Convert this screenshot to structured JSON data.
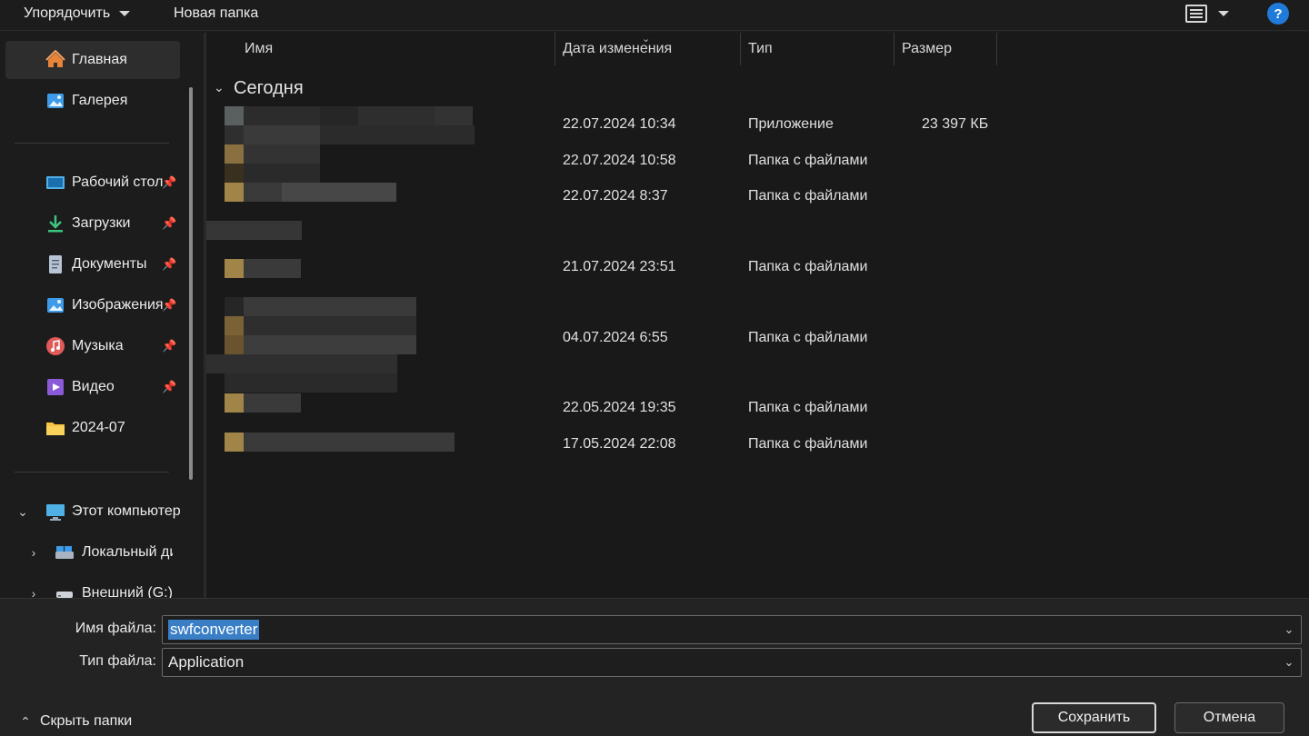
{
  "toolbar": {
    "organize_label": "Упорядочить",
    "new_folder_label": "Новая папка",
    "view_icon": "view-list-icon",
    "help_label": "?"
  },
  "nav": {
    "items": [
      {
        "label": "Главная",
        "icon": "home-icon",
        "color": "#e8833a"
      },
      {
        "label": "Галерея",
        "icon": "gallery-icon",
        "color": "#3d9be9"
      },
      {
        "label": "Рабочий стол",
        "icon": "desktop-icon",
        "color": "#4fb0e6"
      },
      {
        "label": "Загрузки",
        "icon": "download-icon",
        "color": "#3ec57f"
      },
      {
        "label": "Документы",
        "icon": "documents-icon",
        "color": "#b8c4d4"
      },
      {
        "label": "Изображения",
        "icon": "pictures-icon",
        "color": "#3d9be9"
      },
      {
        "label": "Музыка",
        "icon": "music-icon",
        "color": "#e05a5a"
      },
      {
        "label": "Видео",
        "icon": "video-icon",
        "color": "#8a5ad8"
      },
      {
        "label": "2024-07",
        "icon": "folder-icon",
        "color": "#f5c542"
      }
    ],
    "this_pc_label": "Этот компьютер",
    "drives": [
      {
        "label": "Локальный диск",
        "icon": "local-disk-icon"
      },
      {
        "label": "Внешний (G:)",
        "icon": "external-drive-icon"
      }
    ]
  },
  "list": {
    "columns": {
      "name": "Имя",
      "date": "Дата изменения",
      "type": "Тип",
      "size": "Размер"
    },
    "group_label": "Сегодня",
    "rows": [
      {
        "date": "22.07.2024 10:34",
        "type": "Приложение",
        "size": "23 397 КБ"
      },
      {
        "date": "22.07.2024 10:58",
        "type": "Папка с файлами",
        "size": ""
      },
      {
        "date": "22.07.2024 8:37",
        "type": "Папка с файлами",
        "size": ""
      },
      {
        "date": "21.07.2024 23:51",
        "type": "Папка с файлами",
        "size": ""
      },
      {
        "date": "04.07.2024 6:55",
        "type": "Папка с файлами",
        "size": ""
      },
      {
        "date": "22.05.2024 19:35",
        "type": "Папка с файлами",
        "size": ""
      },
      {
        "date": "17.05.2024 22:08",
        "type": "Папка с файлами",
        "size": ""
      }
    ]
  },
  "bottom": {
    "filename_label": "Имя файла:",
    "filename_value": "swfconverter",
    "filetype_label": "Тип файла:",
    "filetype_value": "Application",
    "hide_folders_label": "Скрыть папки",
    "save_label": "Сохранить",
    "cancel_label": "Отмена"
  }
}
